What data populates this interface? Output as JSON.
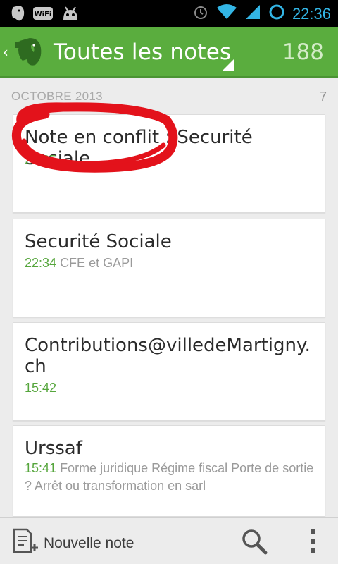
{
  "status_bar": {
    "time": "22:36",
    "left_icons": [
      "evernote-icon",
      "wifi-badge-icon",
      "android-icon"
    ],
    "right_icons": [
      "alarm-icon",
      "wifi-signal-icon",
      "cell-signal-icon",
      "battery-ring-icon"
    ],
    "accent_color": "#33b5e5"
  },
  "action_bar": {
    "back_glyph": "‹",
    "logo_icon": "evernote-elephant-icon",
    "title": "Toutes les notes",
    "count": "188",
    "background_color": "#5aad3e"
  },
  "section": {
    "label": "OCTOBRE 2013",
    "count": "7"
  },
  "notes": [
    {
      "title": "Note en conflit : Securité Sociale",
      "time": "22:35",
      "snippet": ""
    },
    {
      "title": "Securité Sociale",
      "time": "22:34",
      "snippet": "CFE et GAPI"
    },
    {
      "title": "Contributions@villedeMartigny.ch",
      "time": "15:42",
      "snippet": ""
    },
    {
      "title": "Urssaf",
      "time": "15:41",
      "snippet": "Forme juridique Régime fiscal Porte de sortie ? Arrêt ou transformation en sarl"
    }
  ],
  "bottom_bar": {
    "new_note_label": "Nouvelle note",
    "new_note_icon": "new-note-icon",
    "search_icon": "search-icon",
    "overflow_icon": "overflow-menu-icon"
  },
  "annotation": {
    "color": "#e3121b",
    "shape": "hand-drawn-ellipse"
  }
}
